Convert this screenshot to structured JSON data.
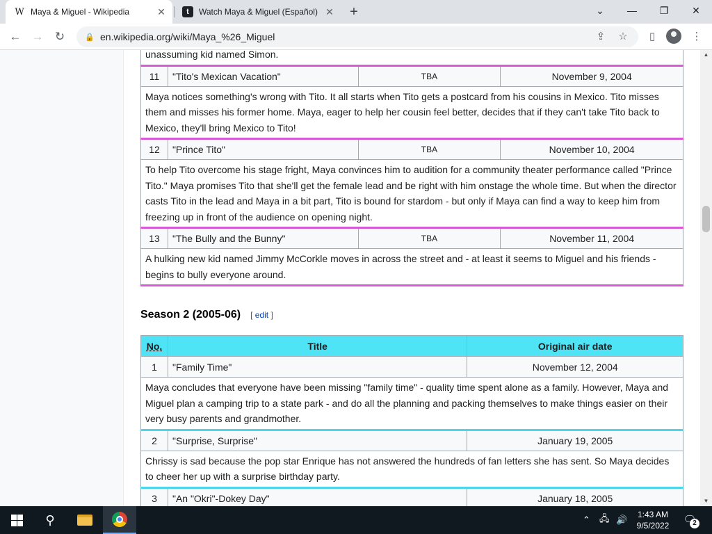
{
  "browser": {
    "tabs": [
      {
        "title": "Maya & Miguel - Wikipedia",
        "favicon": "W",
        "active": true
      },
      {
        "title": "Watch Maya & Miguel (Español)",
        "favicon": "t",
        "active": false
      }
    ],
    "new_tab": "+",
    "url": "en.wikipedia.org/wiki/Maya_%26_Miguel"
  },
  "icons": {
    "back": "←",
    "forward": "→",
    "reload": "↻",
    "lock": "🔒",
    "share": "⇪",
    "star": "☆",
    "sidepanel": "▯",
    "menu": "⋮",
    "close": "✕",
    "minimize": "—",
    "restore": "❐",
    "dropdown": "⌄",
    "search": "⚲",
    "up": "▲",
    "down": "▼",
    "caret": "⌃",
    "network": "🖧",
    "volume": "🔊",
    "notifications": "🗨"
  },
  "season1": {
    "episodes_partial_text": "unassuming kid named Simon.",
    "episodes": [
      {
        "no": "11",
        "title": "\"Tito's Mexican Vacation\"",
        "writer": "TBA",
        "date": "November 9, 2004",
        "summary": "Maya notices something's wrong with Tito. It all starts when Tito gets a postcard from his cousins in Mexico. Tito misses them and misses his former home. Maya, eager to help her cousin feel better, decides that if they can't take Tito back to Mexico, they'll bring Mexico to Tito!"
      },
      {
        "no": "12",
        "title": "\"Prince Tito\"",
        "writer": "TBA",
        "date": "November 10, 2004",
        "summary": "To help Tito overcome his stage fright, Maya convinces him to audition for a community theater performance called \"Prince Tito.\" Maya promises Tito that she'll get the female lead and be right with him onstage the whole time. But when the director casts Tito in the lead and Maya in a bit part, Tito is bound for stardom - but only if Maya can find a way to keep him from freezing up in front of the audience on opening night."
      },
      {
        "no": "13",
        "title": "\"The Bully and the Bunny\"",
        "writer": "TBA",
        "date": "November 11, 2004",
        "summary": "A hulking new kid named Jimmy McCorkle moves in across the street and - at least it seems to Miguel and his friends - begins to bully everyone around."
      }
    ]
  },
  "season2": {
    "heading": "Season 2 (2005-06)",
    "edit_open": "[",
    "edit_label": "edit",
    "edit_close": "]",
    "headers": {
      "no": "No.",
      "title": "Title",
      "date": "Original air date"
    },
    "episodes": [
      {
        "no": "1",
        "title": "\"Family Time\"",
        "date": "November 12, 2004",
        "summary": "Maya concludes that everyone have been missing \"family time\" - quality time spent alone as a family. However, Maya and Miguel plan a camping trip to a state park - and do all the planning and packing themselves to make things easier on their very busy parents and grandmother."
      },
      {
        "no": "2",
        "title": "\"Surprise, Surprise\"",
        "date": "January 19, 2005",
        "summary": "Chrissy is sad because the pop star Enrique has not answered the hundreds of fan letters she has sent. So Maya decides to cheer her up with a surprise birthday party."
      },
      {
        "no": "3",
        "title": "\"An \"Okri\"-Dokey Day\"",
        "date": "January 18, 2005"
      }
    ]
  },
  "taskbar": {
    "time": "1:43 AM",
    "date": "9/5/2022",
    "notification_count": "2"
  }
}
